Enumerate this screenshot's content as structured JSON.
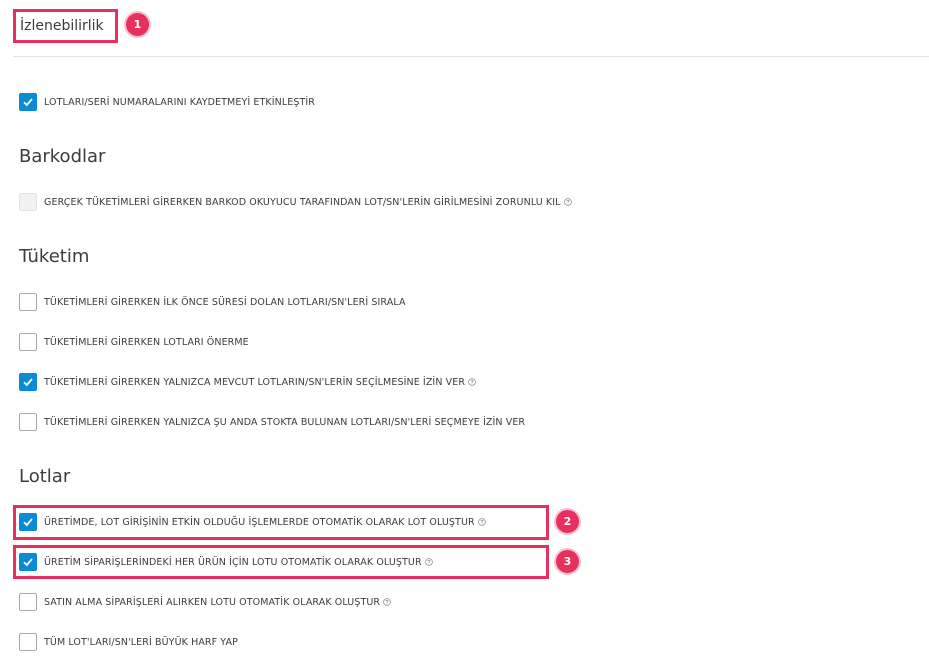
{
  "header": {
    "title": "İzlenebilirlik"
  },
  "badges": [
    "1",
    "2",
    "3"
  ],
  "top_option": {
    "label": "LOTLARI/SERİ NUMARALARINI KAYDETMEYİ ETKİNLEŞTİR",
    "checked": true
  },
  "barcodes": {
    "heading": "Barkodlar",
    "options": [
      {
        "label": "GERÇEK TÜKETİMLERİ GİRERKEN BARKOD OKUYUCU TARAFINDAN LOT/SN'LERİN GİRİLMESİNİ ZORUNLU KIL",
        "checked": false,
        "disabled": true,
        "help_icon": "question-circle-icon"
      }
    ]
  },
  "consumption": {
    "heading": "Tüketim",
    "options": [
      {
        "label": "TÜKETİMLERİ GİRERKEN İLK ÖNCE SÜRESİ DOLAN LOTLARI/SN'LERİ SIRALA",
        "checked": false
      },
      {
        "label": "TÜKETİMLERİ GİRERKEN LOTLARI ÖNERME",
        "checked": false
      },
      {
        "label": "TÜKETİMLERİ GİRERKEN YALNIZCA MEVCUT LOTLARIN/SN'LERİN SEÇİLMESİNE İZİN VER",
        "checked": true,
        "help_icon": "question-circle-icon"
      },
      {
        "label": "TÜKETİMLERİ GİRERKEN YALNIZCA ŞU ANDA STOKTA BULUNAN LOTLARI/SN'LERİ SEÇMEYE İZİN VER",
        "checked": false
      }
    ]
  },
  "lots": {
    "heading": "Lotlar",
    "options": [
      {
        "label": "ÜRETİMDE, LOT GİRİŞİNİN ETKİN OLDUĞU İŞLEMLERDE OTOMATİK OLARAK LOT OLUŞTUR",
        "checked": true,
        "help_icon": "question-circle-icon"
      },
      {
        "label": "ÜRETİM SİPARİŞLERİNDEKİ HER ÜRÜN İÇİN LOTU OTOMATİK OLARAK OLUŞTUR",
        "checked": true,
        "help_icon": "question-circle-icon"
      },
      {
        "label": "SATIN ALMA SİPARİŞLERİ ALIRKEN LOTU OTOMATİK OLARAK OLUŞTUR",
        "checked": false,
        "help_icon": "question-circle-icon"
      },
      {
        "label": "TÜM LOT'LARI/SN'LERİ BÜYÜK HARF YAP",
        "checked": false
      }
    ]
  },
  "colors": {
    "accent": "#0b8ad6",
    "highlight": "#e8305e"
  }
}
